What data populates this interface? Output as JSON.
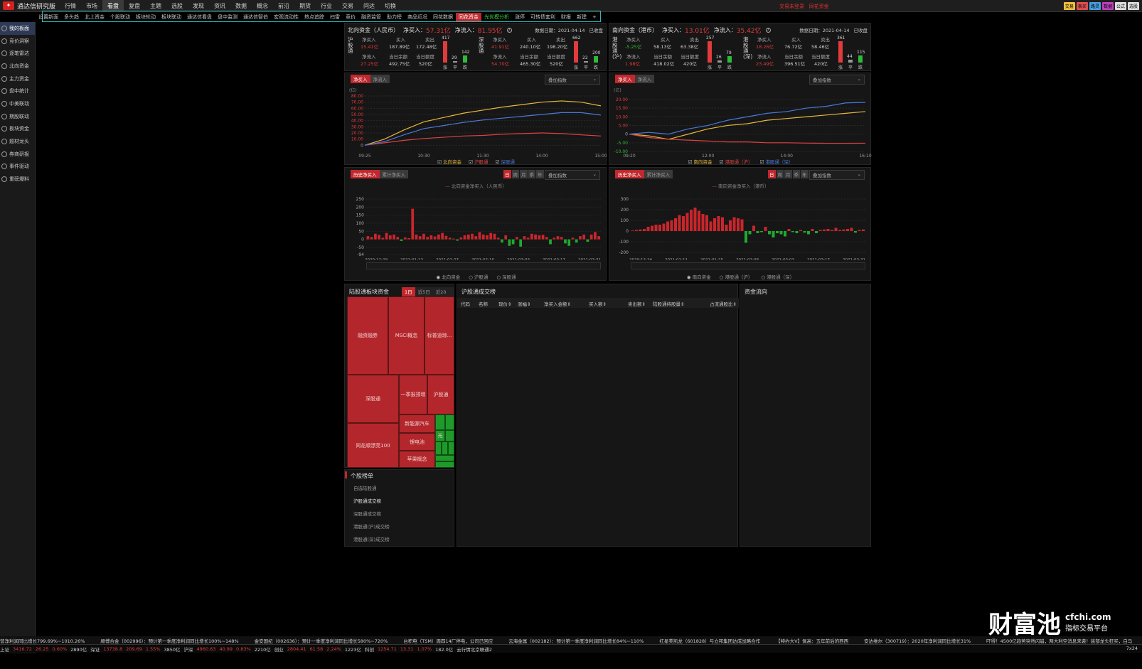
{
  "app": {
    "title": "通达信研究版"
  },
  "menu": [
    "行情",
    "市场",
    "看盘",
    "复盘",
    "主题",
    "选股",
    "发现",
    "资讯",
    "数据",
    "概念",
    "前沿",
    "期货",
    "行业",
    "交易",
    "问达",
    "切换"
  ],
  "menu_active": 2,
  "top_notice": [
    "交易未登录",
    "同花资金"
  ],
  "top_buttons": [
    {
      "label": "交易",
      "color": "#f0c040"
    },
    {
      "label": "表买",
      "color": "#e05050"
    },
    {
      "label": "路灵",
      "color": "#4aa0e0"
    },
    {
      "label": "数据",
      "color": "#c040c0"
    },
    {
      "label": "公式",
      "color": "#e0e0e0"
    },
    {
      "label": "选股",
      "color": "#e0e0e0"
    }
  ],
  "subtabs": [
    "设置新面",
    "多头趋",
    "北上资金",
    "个股联动",
    "板块轮动",
    "板块联动",
    "通达信看盘",
    "盘中监测",
    "通达信智伯",
    "宏观流动性",
    "热点追踪",
    "扫雷",
    "竞价",
    "融资监管",
    "助力榜",
    "商品近况",
    "同花数据",
    "同花资金",
    "光优模分析",
    "涨停",
    "可转债套利",
    "财报",
    "新建"
  ],
  "subtab_red": 17,
  "subtab_green": 18,
  "sidebar": [
    "我的板面",
    "竞价洞察",
    "逐笔雷达",
    "北向资金",
    "主力资金",
    "盘中统计",
    "中美联动",
    "期股联动",
    "板块资金",
    "题材龙头",
    "券商研报",
    "事件驱动",
    "重磅爆料"
  ],
  "north": {
    "title": "北向资金（人民币）",
    "net_buy_label": "净买入：",
    "net_buy": "57.31亿",
    "net_in_label": "净流入：",
    "net_in": "81.95亿",
    "date_label": "数据日期：2021-04-14",
    "status": "已收盘",
    "sh": {
      "name": "沪股通",
      "netbuy_label": "净买入",
      "netbuy": "15.41亿",
      "buy_label": "买入",
      "buy": "187.89亿",
      "sell_label": "卖出",
      "sell": "172.48亿",
      "netin_label": "净流入",
      "netin": "27.25亿",
      "bal_label": "当日余额",
      "bal": "492.75亿",
      "quota_label": "当日额度",
      "quota": "520亿",
      "up": "417",
      "flat": "29",
      "down": "142",
      "l_up": "涨",
      "l_flat": "平",
      "l_down": "跌"
    },
    "sz": {
      "name": "深股通",
      "netbuy_label": "净买入",
      "netbuy": "41.91亿",
      "buy_label": "买入",
      "buy": "240.10亿",
      "sell_label": "卖出",
      "sell": "198.20亿",
      "netin_label": "净流入",
      "netin": "54.70亿",
      "bal_label": "当日余额",
      "bal": "465.30亿",
      "quota_label": "当日额度",
      "quota": "520亿",
      "up": "662",
      "flat": "22",
      "down": "200",
      "l_up": "涨",
      "l_flat": "平",
      "l_down": "跌"
    }
  },
  "south": {
    "title": "南向资金（港币）",
    "net_buy_label": "净买入：",
    "net_buy": "13.01亿",
    "net_in_label": "净流入：",
    "net_in": "35.42亿",
    "date_label": "数据日期：2021-04-14",
    "status": "已收盘",
    "sh": {
      "name": "港股通(沪)",
      "netbuy_label": "净买入",
      "netbuy": "-5.25亿",
      "buy_label": "买入",
      "buy": "58.13亿",
      "sell_label": "卖出",
      "sell": "63.38亿",
      "netin_label": "净流入",
      "netin": "1.98亿",
      "bal_label": "当日余额",
      "bal": "418.02亿",
      "quota_label": "当日额度",
      "quota": "420亿",
      "up": "257",
      "flat": "26",
      "down": "79",
      "l_up": "涨",
      "l_flat": "平",
      "l_down": "跌"
    },
    "sz": {
      "name": "港股通(深)",
      "netbuy_label": "净买入",
      "netbuy": "18.26亿",
      "buy_label": "买入",
      "buy": "76.72亿",
      "sell_label": "卖出",
      "sell": "58.46亿",
      "netin_label": "净流入",
      "netin": "23.49亿",
      "bal_label": "当日余额",
      "bal": "396.51亿",
      "quota_label": "当日额度",
      "quota": "420亿",
      "up": "361",
      "flat": "44",
      "down": "115",
      "l_up": "涨",
      "l_flat": "平",
      "l_down": "跌"
    }
  },
  "intraday_tabs": [
    "净买入",
    "净流入"
  ],
  "overlay_label": "叠加指数",
  "north_intraday_legend": [
    "北向资金",
    "沪股通",
    "深股通"
  ],
  "south_intraday_legend": [
    "南向资金",
    "港股通（沪）",
    "港股通（深）"
  ],
  "hist_tabs": [
    "历史净买入",
    "累计净买入"
  ],
  "period_tabs": [
    "日",
    "周",
    "月",
    "季",
    "年"
  ],
  "north_hist_legend": [
    "北向资金",
    "沪股通",
    "深股通"
  ],
  "south_hist_legend": [
    "南向资金",
    "港股通（沪）",
    "港股通（深）"
  ],
  "treemap": {
    "title": "陆股通板块资金",
    "periods": [
      "1日",
      "近5日",
      "近20日"
    ],
    "cells": [
      "融资融券",
      "MSCI概念",
      "标普道琼...",
      "深股通",
      "一季报预增",
      "沪股通",
      "新能源汽车",
      "锂电池",
      "同花顺漂亮100",
      "苹果概念",
      "光",
      "光"
    ]
  },
  "stock_list": {
    "title": "个股榜单",
    "items": [
      "自选陆股通",
      "沪股通成交榜",
      "深股通成交榜",
      "港股通(沪)成交榜",
      "港股通(深)成交榜"
    ]
  },
  "table": {
    "title": "沪股通成交榜",
    "columns": [
      "代码",
      "名称",
      "现价",
      "涨幅",
      "净买入金额",
      "买入额",
      "卖出额",
      "陆股通持股量",
      "占流通股比"
    ]
  },
  "flow": {
    "title": "资金流向"
  },
  "ticker": [
    "营净利润同比增长799.69%~1010.26%",
    "顺博合金（002996）：预计第一季度净利润同比增长100%~148%",
    "金安国纪（002636）：预计一季度净利润同比增长580%~720%",
    "台积电（TSM）周四14厂停电，公司已回应",
    "云海金属（002182）：预计第一季度净利润同比增长84%~110%",
    "红星美凯龙（601828）与立邦集团达成战略合作",
    "【特约大V】佩高：五年前后的西西",
    "安达维尔（300719）：2020年净利润同比增长31%",
    "吓得！4500亿趋势突然闪崩，两大利空消息来袭！底部龙头狂买，白马"
  ],
  "status": [
    {
      "t": "上证",
      "c": "#d0d0d0"
    },
    {
      "t": "3416.72",
      "c": "#e23b3b"
    },
    {
      "t": "26.25",
      "c": "#e23b3b"
    },
    {
      "t": "0.60%",
      "c": "#e23b3b"
    },
    {
      "t": "2890亿",
      "c": "#d0d0d0"
    },
    {
      "t": "深证",
      "c": "#d0d0d0"
    },
    {
      "t": "13738.8",
      "c": "#e23b3b"
    },
    {
      "t": "209.69",
      "c": "#e23b3b"
    },
    {
      "t": "1.55%",
      "c": "#e23b3b"
    },
    {
      "t": "3850亿",
      "c": "#d0d0d0"
    },
    {
      "t": "沪深",
      "c": "#d0d0d0"
    },
    {
      "t": "4960.63",
      "c": "#e23b3b"
    },
    {
      "t": "40.99",
      "c": "#e23b3b"
    },
    {
      "t": "0.83%",
      "c": "#e23b3b"
    },
    {
      "t": "2210亿",
      "c": "#d0d0d0"
    },
    {
      "t": "创业",
      "c": "#d0d0d0"
    },
    {
      "t": "2804.41",
      "c": "#e23b3b"
    },
    {
      "t": "61.58",
      "c": "#e23b3b"
    },
    {
      "t": "2.24%",
      "c": "#e23b3b"
    },
    {
      "t": "1223亿",
      "c": "#d0d0d0"
    },
    {
      "t": "科创",
      "c": "#d0d0d0"
    },
    {
      "t": "1254.71",
      "c": "#e23b3b"
    },
    {
      "t": "13.31",
      "c": "#e23b3b"
    },
    {
      "t": "1.07%",
      "c": "#e23b3b"
    },
    {
      "t": "182.0亿",
      "c": "#d0d0d0"
    },
    {
      "t": "云行情北京联通2",
      "c": "#d0d0d0"
    }
  ],
  "status_right": "7x24",
  "watermark": {
    "brand": "财富池",
    "domain": "cfchi.com",
    "slogan": "指标交易平台"
  },
  "chart_data": [
    {
      "type": "line",
      "x_ticks": [
        "09:25",
        "10:30",
        "11:30",
        "14:00",
        "15:00"
      ],
      "ylabel": "(亿)",
      "ylim": [
        -10,
        80
      ],
      "y_ticks": [
        "80.00",
        "70.00",
        "60.00",
        "50.00",
        "40.00",
        "30.00",
        "20.00",
        "10.00",
        "0"
      ],
      "series": [
        {
          "name": "北向资金",
          "color": "#e8b83a",
          "values": [
            0,
            10,
            25,
            38,
            45,
            52,
            57,
            62,
            66,
            70,
            72,
            70,
            64
          ]
        },
        {
          "name": "沪股通",
          "color": "#e04040",
          "values": [
            0,
            4,
            8,
            11,
            13,
            15,
            16,
            18,
            19,
            20,
            19,
            17,
            15
          ]
        },
        {
          "name": "深股通",
          "color": "#4a78d8",
          "values": [
            0,
            6,
            17,
            27,
            32,
            37,
            41,
            44,
            47,
            50,
            53,
            53,
            49
          ]
        }
      ]
    },
    {
      "type": "line",
      "x_ticks": [
        "09:20",
        "12:00",
        "14:00",
        "16:10"
      ],
      "ylabel": "(亿)",
      "ylim": [
        -10,
        22
      ],
      "y_ticks": [
        "20.00",
        "15.00",
        "10.00",
        "5.00",
        "0",
        "-5.00",
        "-10.00"
      ],
      "series": [
        {
          "name": "南向资金",
          "color": "#e8b83a",
          "values": [
            0,
            -1,
            -3,
            0,
            3,
            5,
            6,
            8,
            9,
            10,
            11,
            12,
            13
          ]
        },
        {
          "name": "港股通（沪）",
          "color": "#e04040",
          "values": [
            0,
            -2,
            -3,
            -3.5,
            -4,
            -4.5,
            -4.5,
            -5,
            -5,
            -5.2,
            -5.3,
            -5.3,
            -5.25
          ]
        },
        {
          "name": "港股通（深）",
          "color": "#4a78d8",
          "values": [
            0,
            1,
            0,
            3,
            5,
            8,
            10,
            12,
            13,
            15,
            16,
            18,
            18.3
          ]
        }
      ]
    },
    {
      "type": "bar",
      "title": "北向资金净买入（人民币）",
      "x_ticks": [
        "2020-12-29",
        "2021-01-13",
        "2021-01-27",
        "2021-02-10",
        "2021-03-03",
        "2021-03-17",
        "2021-03-31"
      ],
      "y_ticks": [
        "250",
        "200",
        "150",
        "100",
        "50",
        "0",
        "-50",
        "-94"
      ],
      "ylim": [
        -94,
        250
      ],
      "values": [
        20,
        15,
        35,
        28,
        10,
        40,
        25,
        30,
        15,
        -10,
        12,
        8,
        190,
        30,
        20,
        35,
        15,
        25,
        18,
        30,
        40,
        22,
        10,
        5,
        -8,
        12,
        25,
        30,
        35,
        20,
        45,
        30,
        25,
        40,
        35,
        10,
        -20,
        25,
        -40,
        -30,
        15,
        -45,
        20,
        10,
        35,
        30,
        25,
        28,
        15,
        -30,
        10,
        20,
        15,
        -25,
        -40,
        10,
        -20,
        20,
        30,
        -15,
        30,
        45,
        20
      ]
    },
    {
      "type": "bar",
      "title": "南向资金净买入（港币）",
      "x_ticks": [
        "2020-12-24",
        "2021-01-11",
        "2021-01-25",
        "2021-02-08",
        "2021-03-03",
        "2021-03-17",
        "2021-03-31"
      ],
      "y_ticks": [
        "300",
        "200",
        "100",
        "0",
        "-100",
        "-200"
      ],
      "ylim": [
        -220,
        300
      ],
      "values": [
        5,
        10,
        15,
        20,
        40,
        50,
        60,
        60,
        70,
        90,
        100,
        120,
        150,
        140,
        170,
        200,
        220,
        190,
        160,
        150,
        90,
        120,
        140,
        130,
        60,
        100,
        130,
        120,
        110,
        -110,
        -30,
        50,
        -20,
        -10,
        40,
        -30,
        -60,
        -20,
        -30,
        -50,
        20,
        -10,
        -20,
        10,
        -15,
        -30,
        20,
        -20,
        10,
        15,
        20,
        10,
        30,
        10,
        15,
        20,
        30,
        -15,
        10,
        15
      ]
    }
  ]
}
